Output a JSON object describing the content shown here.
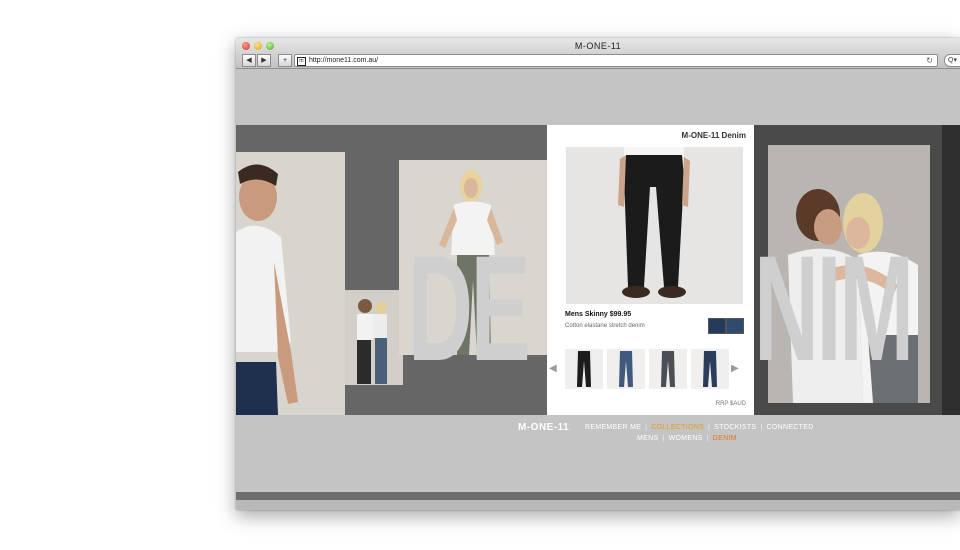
{
  "window": {
    "title": "M-ONE-11",
    "url": "http://mone11.com.au/"
  },
  "toolbar": {
    "back_icon": "back-icon",
    "forward_icon": "forward-icon",
    "add_icon": "plus-icon",
    "reload_icon": "reload-icon",
    "search_icon": "search-icon",
    "back_glyph": "◀",
    "forward_glyph": "▶",
    "add_glyph": "+",
    "reload_glyph": "↻",
    "search_glyph": "Q▾",
    "favicon": "m"
  },
  "hero": {
    "big_text_left": "DE",
    "big_text_right": "NIM"
  },
  "product": {
    "panel_title": "M-ONE-11 Denim",
    "name": "Mens Skinny $99.95",
    "description": "Cotton elastane stretch denim",
    "rrp": "RRP $AUD",
    "prev_glyph": "◀",
    "next_glyph": "▶"
  },
  "footer": {
    "logo": "M-ONE-11",
    "nav_primary": [
      "REMEMBER ME",
      "COLLECTIONS",
      "STOCKISTS",
      "CONNECTED"
    ],
    "nav_secondary": [
      "MENS",
      "WOMENS",
      "DENIM"
    ],
    "separator": "|"
  },
  "colors": {
    "active_primary": "#e89a1b",
    "active_secondary": "#e0781c",
    "swatch": "#233a59"
  }
}
